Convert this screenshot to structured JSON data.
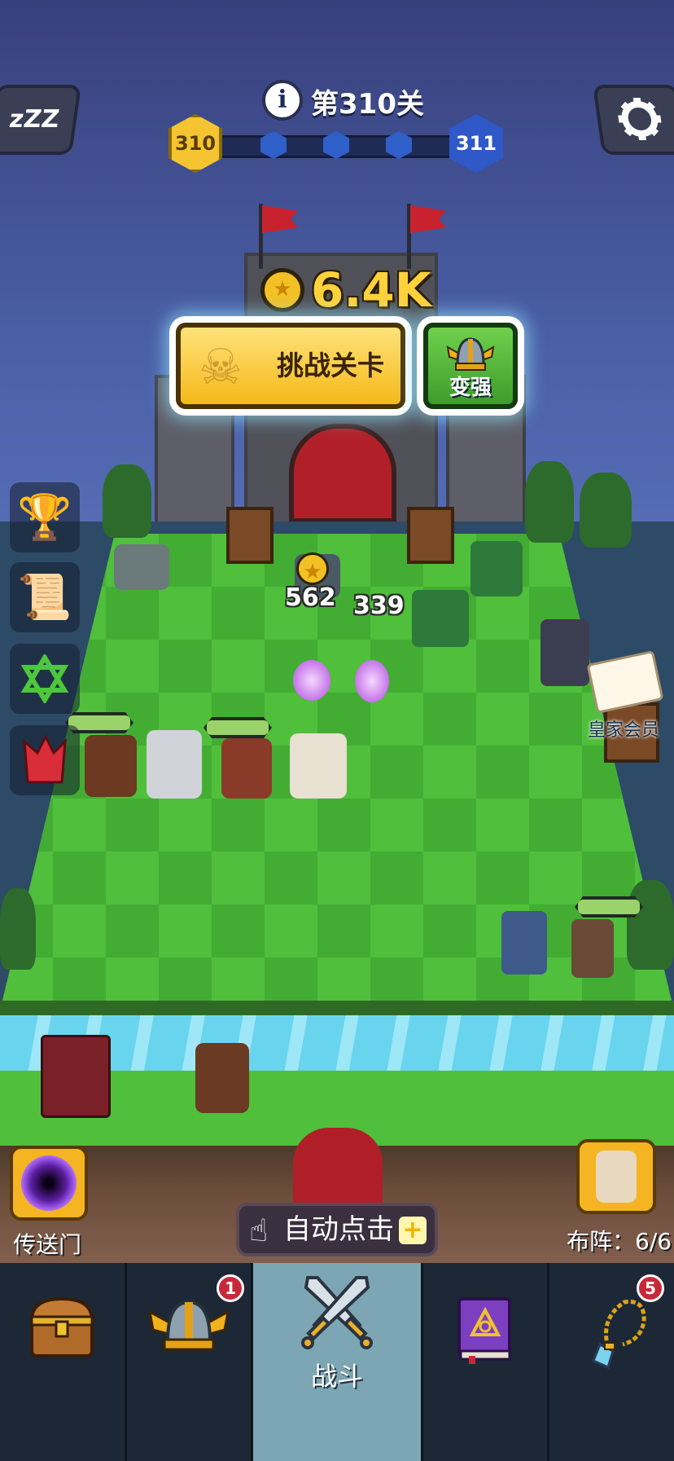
{
  "header": {
    "sleep_icon_text": "zZZ",
    "info_icon_text": "i",
    "level_title": "第310关",
    "current_level": "310",
    "next_level": "311"
  },
  "castle": {
    "gold_amount": "6.4K",
    "challenge_button": "挑战关卡",
    "strengthen_button": "变强"
  },
  "battle": {
    "damage_numbers": [
      "562",
      "339"
    ],
    "royal_member_label": "皇家会员"
  },
  "controls": {
    "portal_label": "传送门",
    "auto_click_label": "自动点击",
    "auto_click_plus": "+",
    "formation_label": "布阵：6/6"
  },
  "nav": {
    "items": [
      {
        "name": "chest",
        "label": ""
      },
      {
        "name": "heroes",
        "label": "",
        "badge": "1"
      },
      {
        "name": "battle",
        "label": "战斗"
      },
      {
        "name": "spellbook",
        "label": ""
      },
      {
        "name": "amulet",
        "label": "",
        "badge": "5"
      }
    ]
  },
  "colors": {
    "gold": "#f4c531",
    "challenge_button": "#f5b919",
    "strengthen_button": "#3d9c2c",
    "nav_background": "#1d2836",
    "nav_active": "#7ca6b3",
    "badge": "#c8293a"
  }
}
